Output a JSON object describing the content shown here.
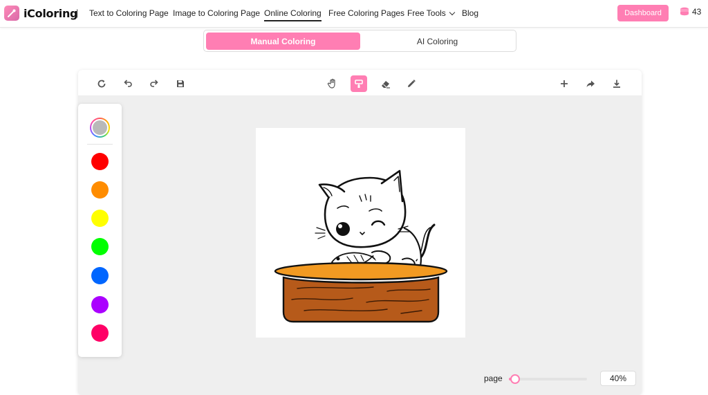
{
  "header": {
    "logo_text": "iColoring",
    "separator": "|",
    "nav": [
      {
        "label": "Text to Coloring Page"
      },
      {
        "label": "Image to Coloring Page"
      },
      {
        "label": "Online Coloring",
        "active": true
      },
      {
        "label": "Free Coloring Pages"
      },
      {
        "label": "Free Tools"
      },
      {
        "label": "Blog"
      }
    ],
    "dashboard_label": "Dashboard",
    "credits": "43"
  },
  "mode_toggle": {
    "manual_label": "Manual Coloring",
    "ai_label": "AI Coloring",
    "selected": "Manual Coloring"
  },
  "toolbar": {
    "left_tools": [
      "refresh-icon",
      "undo-icon",
      "redo-icon",
      "save-icon"
    ],
    "center_tools": [
      "hand-icon",
      "paint-bucket-icon",
      "eraser-icon",
      "pencil-icon"
    ],
    "selected_tool": "paint-bucket-icon",
    "right_tools": [
      "plus-icon",
      "share-icon",
      "download-icon"
    ]
  },
  "palette": {
    "current_color": "#b9b9b9",
    "colors": [
      "#ff0000",
      "#ff8c00",
      "#ffff00",
      "#00ff00",
      "#0066ff",
      "#aa00ff",
      "#ff0066"
    ]
  },
  "zoom": {
    "page_label": "page",
    "value": "40%",
    "slider_fraction": 0.08
  },
  "colors": {
    "accent": "#ff7eb3",
    "table_top": "#f29a22",
    "table_body": "#b65a1a"
  }
}
